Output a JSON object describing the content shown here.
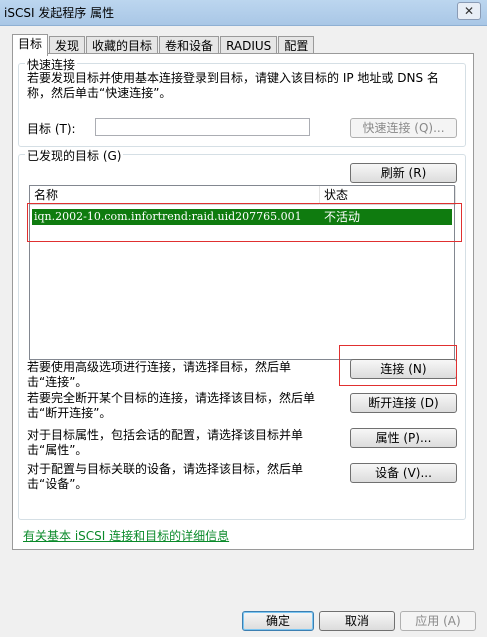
{
  "window": {
    "title": "iSCSI 发起程序 属性",
    "close_glyph": "✕"
  },
  "tabs": [
    "目标",
    "发现",
    "收藏的目标",
    "卷和设备",
    "RADIUS",
    "配置"
  ],
  "quick_connect": {
    "group_label": "快速连接",
    "description": "若要发现目标并使用基本连接登录到目标，请键入该目标的 IP 地址或 DNS 名称，然后单击“快速连接”。",
    "target_label": "目标 (T):",
    "target_value": "",
    "button": "快速连接 (Q)..."
  },
  "discovered": {
    "group_label": "已发现的目标 (G)",
    "refresh_button": "刷新 (R)",
    "columns": [
      "名称",
      "状态"
    ],
    "rows": [
      {
        "name": "iqn.2002-10.com.infortrend:raid.uid207765.001",
        "status": "不活动"
      }
    ]
  },
  "actions": [
    {
      "text": "若要使用高级选项进行连接，请选择目标，然后单击“连接”。",
      "button": "连接 (N)"
    },
    {
      "text": "若要完全断开某个目标的连接，请选择该目标，然后单击“断开连接”。",
      "button": "断开连接 (D)"
    },
    {
      "text": "对于目标属性，包括会话的配置，请选择该目标并单击“属性”。",
      "button": "属性 (P)..."
    },
    {
      "text": "对于配置与目标关联的设备，请选择该目标，然后单击“设备”。",
      "button": "设备 (V)..."
    }
  ],
  "info_link": "有关基本 iSCSI 连接和目标的详细信息",
  "footer": {
    "ok": "确定",
    "cancel": "取消",
    "apply": "应用 (A)"
  }
}
